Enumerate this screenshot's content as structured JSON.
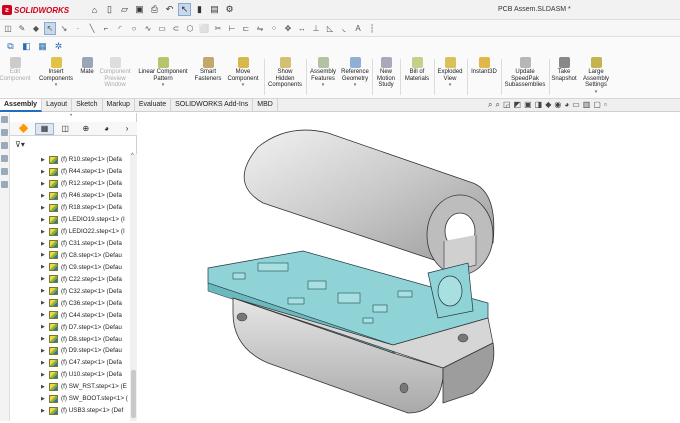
{
  "app": {
    "brand": "SOLIDWORKS",
    "doc_title": "PCB Assem.SLDASM *"
  },
  "command_manager": [
    {
      "label": "Edit\nComponent",
      "disabled": true
    },
    {
      "label": "Insert\nComponents",
      "disabled": false
    },
    {
      "label": "Mate",
      "disabled": false
    },
    {
      "label": "Component\nPreview\nWindow",
      "disabled": true
    },
    {
      "label": "Linear Component\nPattern",
      "disabled": false
    },
    {
      "label": "Smart\nFasteners",
      "disabled": false
    },
    {
      "label": "Move\nComponent",
      "disabled": false
    },
    {
      "label": "Show\nHidden\nComponents",
      "disabled": false
    },
    {
      "label": "Assembly\nFeatures",
      "disabled": false
    },
    {
      "label": "Reference\nGeometry",
      "disabled": false
    },
    {
      "label": "New\nMotion\nStudy",
      "disabled": false
    },
    {
      "label": "Bill of\nMaterials",
      "disabled": false
    },
    {
      "label": "Exploded\nView",
      "disabled": false
    },
    {
      "label": "Instant3D",
      "disabled": false
    },
    {
      "label": "Update\nSpeedPak\nSubassemblies",
      "disabled": false
    },
    {
      "label": "Take\nSnapshot",
      "disabled": false
    },
    {
      "label": "Large\nAssembly\nSettings",
      "disabled": false
    }
  ],
  "tabs": [
    "Assembly",
    "Layout",
    "Sketch",
    "Markup",
    "Evaluate",
    "SOLIDWORKS Add-Ins",
    "MBD"
  ],
  "active_tab": "Assembly",
  "tree": {
    "items": [
      "(f) R10.step<1> (Defa",
      "(f) R44.step<1> (Defa",
      "(f) R12.step<1> (Defa",
      "(f) R46.step<1> (Defa",
      "(f) R18.step<1> (Defa",
      "(f) LEDIO19.step<1> (I",
      "(f) LEDIO22.step<1> (I",
      "(f) C31.step<1> (Defa",
      "(f) C8.step<1> (Defau",
      "(f) C9.step<1> (Defau",
      "(f) C22.step<1> (Defa",
      "(f) C32.step<1> (Defa",
      "(f) C36.step<1> (Defa",
      "(f) C44.step<1> (Defa",
      "(f) D7.step<1> (Defau",
      "(f) D8.step<1> (Defau",
      "(f) D9.step<1> (Defau",
      "(f) C47.step<1> (Defa",
      "(f) U10.step<1> (Defa",
      "(f) SW_RST.step<1> (E",
      "(f) SW_BOOT.step<1> (",
      "(f) USB3.step<1> (Def"
    ]
  },
  "colors": {
    "pcb": "#8fd3d6",
    "housing": "#d9d9d9",
    "accent": "#1f6fbf",
    "brand": "#d0021b"
  }
}
